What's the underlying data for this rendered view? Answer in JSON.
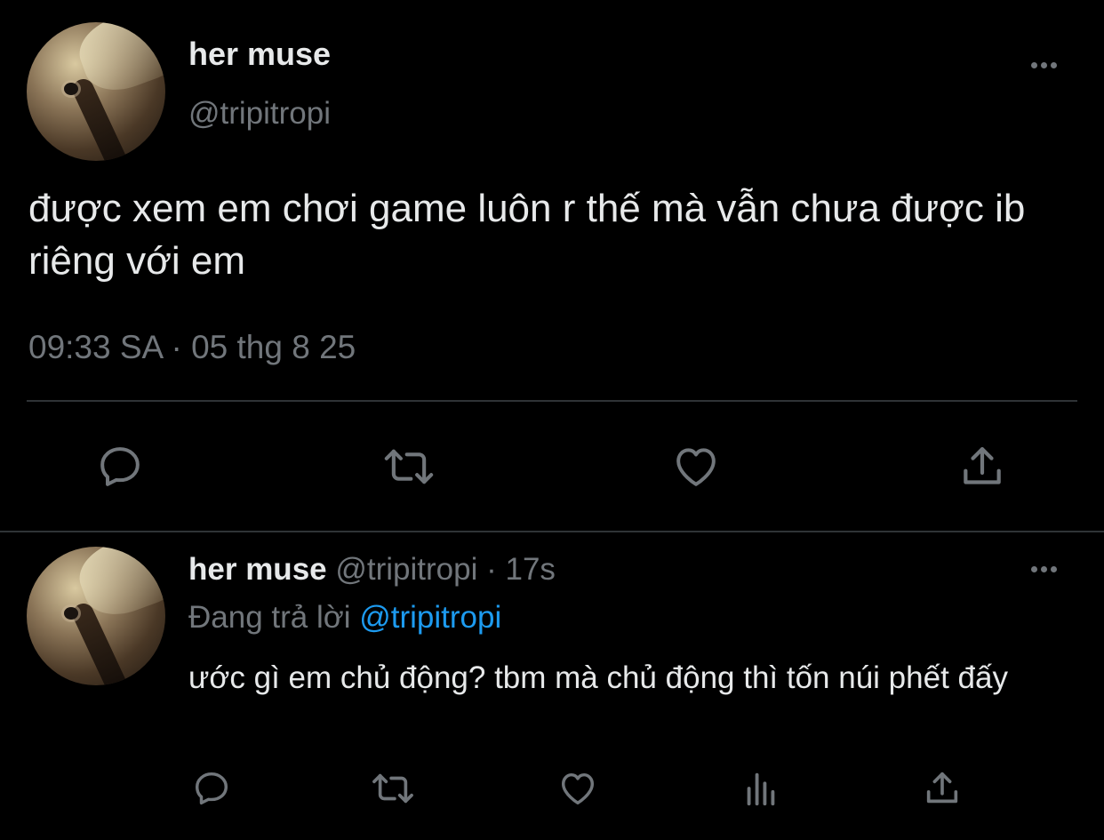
{
  "colors": {
    "background": "#000000",
    "primary_text": "#e7e9ea",
    "secondary_text": "#71767b",
    "link": "#1d9bf0",
    "divider": "#2f3336"
  },
  "main_tweet": {
    "display_name": "her muse",
    "handle": "@tripitropi",
    "text": "được xem em chơi game luôn r thế mà vẫn chưa được ib riêng với em",
    "timestamp": "09:33 SA · 05 thg 8 25",
    "actions": [
      "reply-icon",
      "retweet-icon",
      "like-icon",
      "share-icon"
    ]
  },
  "reply_tweet": {
    "display_name": "her muse",
    "handle": "@tripitropi",
    "separator": " · ",
    "age": "17s",
    "replying_prefix": "Đang trả lời ",
    "replying_to": "@tripitropi",
    "text": "ước gì em chủ động? tbm mà chủ động thì tốn núi phết đấy",
    "actions": [
      "reply-icon",
      "retweet-icon",
      "like-icon",
      "analytics-icon",
      "share-icon"
    ]
  }
}
